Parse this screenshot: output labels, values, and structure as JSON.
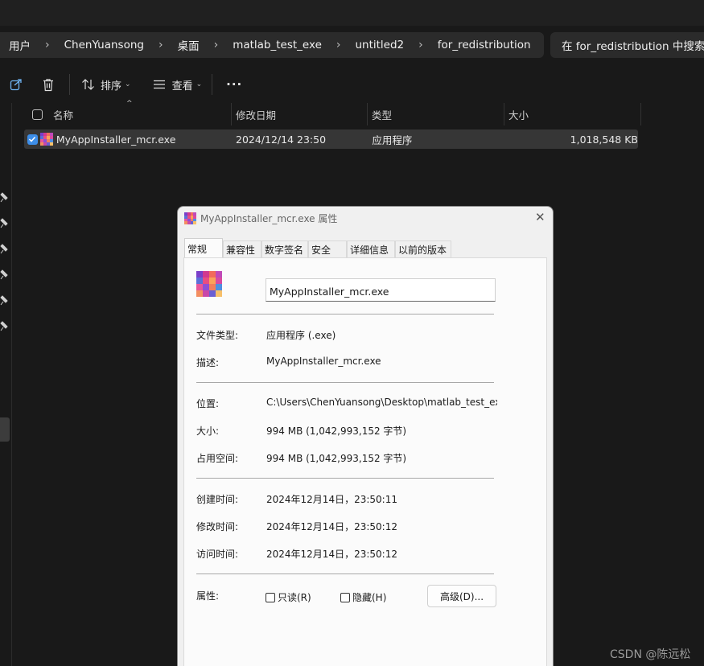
{
  "breadcrumb": [
    "用户",
    "ChenYuansong",
    "桌面",
    "matlab_test_exe",
    "untitled2",
    "for_redistribution"
  ],
  "search": {
    "placeholder": "在 for_redistribution 中搜索"
  },
  "toolbar": {
    "sort_label": "排序",
    "view_label": "查看",
    "more_label": "···"
  },
  "columns": {
    "name": "名称",
    "modified": "修改日期",
    "type": "类型",
    "size": "大小"
  },
  "file_row": {
    "name": "MyAppInstaller_mcr.exe",
    "modified": "2024/12/14 23:50",
    "type": "应用程序",
    "size": "1,018,548 KB",
    "checked": true
  },
  "dialog": {
    "title": "MyAppInstaller_mcr.exe 属性",
    "tabs": [
      "常规",
      "兼容性",
      "数字签名",
      "安全",
      "详细信息",
      "以前的版本"
    ],
    "active_tab": "常规",
    "file_name_value": "MyAppInstaller_mcr.exe",
    "labels": {
      "file_type": "文件类型:",
      "description": "描述:",
      "location": "位置:",
      "size": "大小:",
      "size_on_disk": "占用空间:",
      "created": "创建时间:",
      "modified": "修改时间:",
      "accessed": "访问时间:",
      "attributes": "属性:"
    },
    "values": {
      "file_type": "应用程序 (.exe)",
      "description": "MyAppInstaller_mcr.exe",
      "location": "C:\\Users\\ChenYuansong\\Desktop\\matlab_test_exe",
      "size": "994 MB (1,042,993,152 字节)",
      "size_on_disk": "994 MB (1,042,993,152 字节)",
      "created": "2024年12月14日，23:50:11",
      "modified": "2024年12月14日，23:50:12",
      "accessed": "2024年12月14日，23:50:12"
    },
    "readonly_label": "只读(R)",
    "hidden_label": "隐藏(H)",
    "advanced_label": "高级(D)..."
  },
  "watermark": "CSDN @陈远松",
  "colors": {
    "background": "#191919",
    "address_bar": "#2b2b2b",
    "selected_row": "#363636",
    "checkbox_blue": "#3d8ee8",
    "dialog_bg": "#f0f0f0",
    "panel_bg": "#fbfbfb"
  },
  "icons": {
    "share": "share-icon",
    "delete": "trash-icon",
    "sort": "sort-arrows-icon",
    "view": "view-list-icon",
    "close": "close-icon",
    "app": "exe-app-icon",
    "pin": "pin-icon",
    "chevron": "chevron-right-icon"
  }
}
